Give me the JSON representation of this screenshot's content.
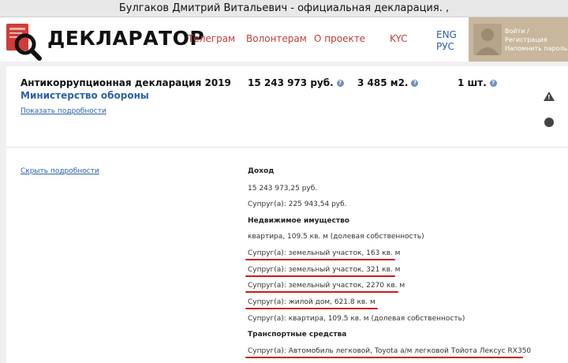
{
  "window": {
    "title": "Булгаков Дмитрий Витальевич - официальная декларация. ,"
  },
  "header": {
    "logo_text": "ДЕКЛАРАТОР",
    "nav": [
      {
        "label": "Телеграм"
      },
      {
        "label": "Волонтерам"
      },
      {
        "label": "О проекте"
      },
      {
        "label": "KYC"
      }
    ],
    "lang": {
      "eng": "ENG",
      "rus": "РУС"
    },
    "login": {
      "signin": "Войти / Регистрация",
      "remind": "Напомнить пароль"
    }
  },
  "declaration": {
    "title": "Антикоррупционная декларация 2019",
    "ministry": "Министерство обороны",
    "show_details": "Показать подробности",
    "hide_details": "Скрыть подробности",
    "income_total": "15 243 973 руб.",
    "area_total": "3 485 м2.",
    "vehicles_total": "1 шт."
  },
  "details": {
    "income_header": "Доход",
    "income_value": "15 243 973,25 руб.",
    "spouse_income": "Супруг(а): 225 943,54 руб.",
    "realty_header": "Недвижимое имущество",
    "realty_items": [
      "квартира, 109.5 кв. м (долевая собственность)",
      "Супруг(а): земельный участок, 163 кв. м",
      "Супруг(а): земельный участок, 321 кв. м",
      "Супруг(а): земельный участок, 2270 кв. м",
      "Супруг(а): жилой дом, 621.8 кв. м",
      "Супруг(а): квартира, 109.5 кв. м (долевая собственность)"
    ],
    "vehicles_header": "Транспортные средства",
    "vehicle_items": [
      "Супруг(а): Автомобиль легковой, Toyota а/м легковой Тойота Лексус RX350"
    ]
  },
  "colors": {
    "accent_red": "#c43a3a",
    "link_blue": "#2c62a8",
    "underline_red": "#d01818",
    "login_bg": "#c8b79d"
  },
  "icons": [
    "logo-document-magnifier-icon",
    "help-icon",
    "warning-icon",
    "circle-icon",
    "user-avatar-icon"
  ]
}
